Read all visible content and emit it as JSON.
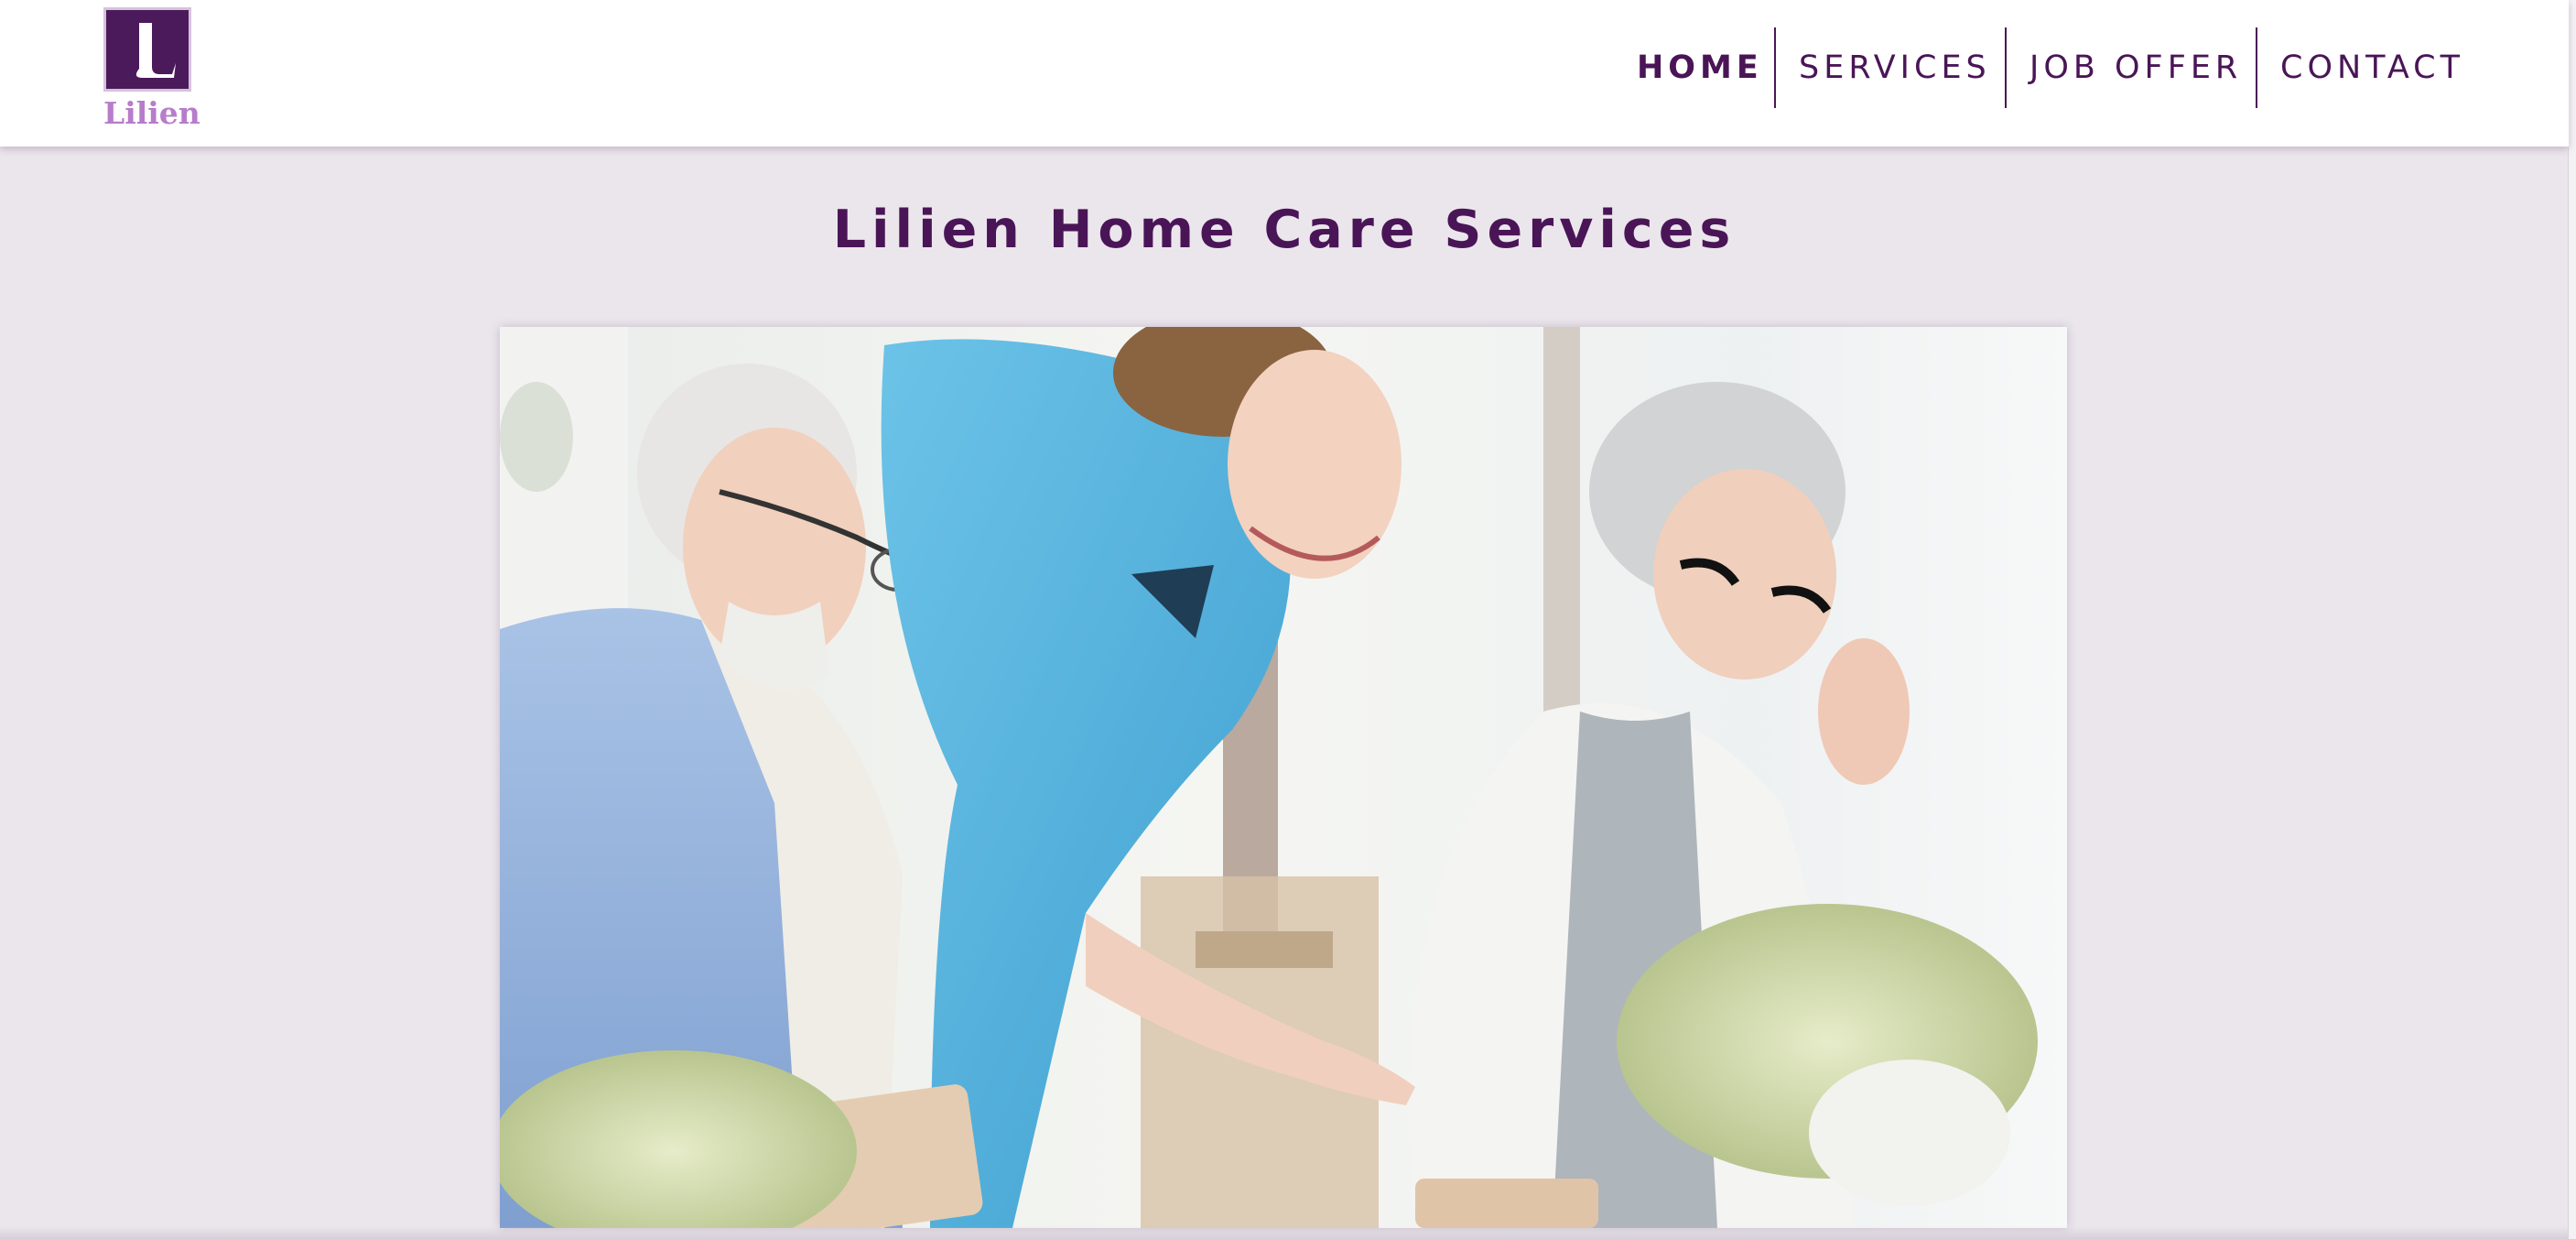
{
  "logo": {
    "alt": "Lilien",
    "wordmark": "Lilien"
  },
  "nav": {
    "items": [
      {
        "label": "HOME",
        "active": true
      },
      {
        "label": "SERVICES",
        "active": false
      },
      {
        "label": "JOB OFFER",
        "active": false
      },
      {
        "label": "CONTACT",
        "active": false
      }
    ]
  },
  "main": {
    "title": "Lilien Home Care Services",
    "hero_alt": "Caregiver in blue scrubs helping an elderly man and woman with a tablet"
  },
  "colors": {
    "brand_purple": "#4a1557",
    "logo_accent": "#b77ccb",
    "page_background": "#ebe6ec"
  }
}
